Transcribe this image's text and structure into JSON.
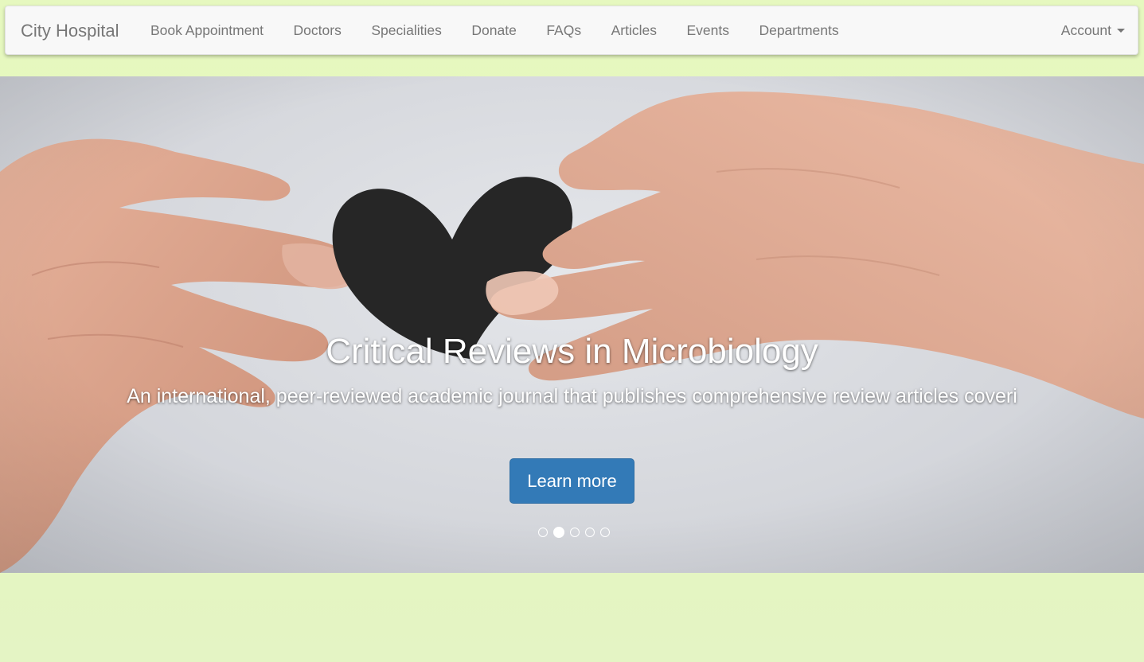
{
  "navbar": {
    "brand": "City Hospital",
    "items": [
      {
        "label": "Book Appointment"
      },
      {
        "label": "Doctors"
      },
      {
        "label": "Specialities"
      },
      {
        "label": "Donate"
      },
      {
        "label": "FAQs"
      },
      {
        "label": "Articles"
      },
      {
        "label": "Events"
      },
      {
        "label": "Departments"
      }
    ],
    "account_label": "Account",
    "account_icon": "caret-down-icon"
  },
  "carousel": {
    "title": "Critical Reviews in Microbiology",
    "description": "An international, peer-reviewed academic journal that publishes comprehensive review articles coveri",
    "button_label": "Learn more",
    "slide_count": 5,
    "active_slide": 2,
    "image": "hands-holding-black-paper-heart"
  },
  "colors": {
    "page_background": "#e3f7bd",
    "primary_button": "#337ab7",
    "navbar_background": "#f8f8f8",
    "nav_text": "#777777"
  }
}
